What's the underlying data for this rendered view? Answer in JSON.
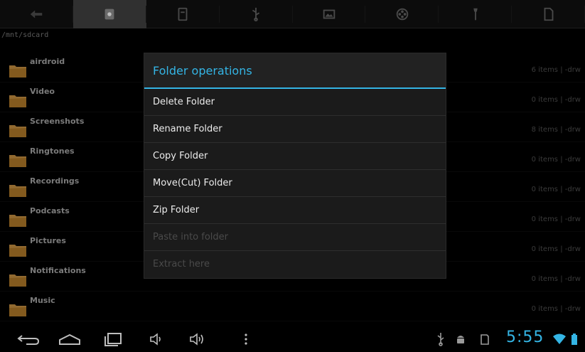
{
  "path": "/mnt/sdcard",
  "toolbar": {
    "items": [
      {
        "icon": "back-arrow-icon"
      },
      {
        "icon": "sdcard-icon",
        "active": true
      },
      {
        "icon": "document-icon"
      },
      {
        "icon": "usb-icon"
      },
      {
        "icon": "image-icon"
      },
      {
        "icon": "film-reel-icon"
      },
      {
        "icon": "tools-icon"
      },
      {
        "icon": "file-icon"
      }
    ]
  },
  "folders": [
    {
      "name": "airdroid",
      "meta": "6 items | -drw"
    },
    {
      "name": "Video",
      "meta": "0 items | -drw"
    },
    {
      "name": "Screenshots",
      "meta": "8 items | -drw"
    },
    {
      "name": "Ringtones",
      "meta": "0 items | -drw"
    },
    {
      "name": "Recordings",
      "meta": "0 items | -drw"
    },
    {
      "name": "Podcasts",
      "meta": "0 items | -drw"
    },
    {
      "name": "Pictures",
      "meta": "0 items | -drw"
    },
    {
      "name": "Notifications",
      "meta": "0 items | -drw"
    },
    {
      "name": "Music",
      "meta": "0 items | -drw"
    }
  ],
  "dialog": {
    "title": "Folder operations",
    "options": [
      {
        "label": "Delete Folder",
        "enabled": true
      },
      {
        "label": "Rename Folder",
        "enabled": true
      },
      {
        "label": "Copy Folder",
        "enabled": true
      },
      {
        "label": "Move(Cut) Folder",
        "enabled": true
      },
      {
        "label": "Zip Folder",
        "enabled": true
      },
      {
        "label": "Paste into folder",
        "enabled": false
      },
      {
        "label": "Extract here",
        "enabled": false
      }
    ]
  },
  "status": {
    "time": "5:55"
  },
  "colors": {
    "accent": "#34b5e5",
    "folder": "#e0a44a"
  }
}
